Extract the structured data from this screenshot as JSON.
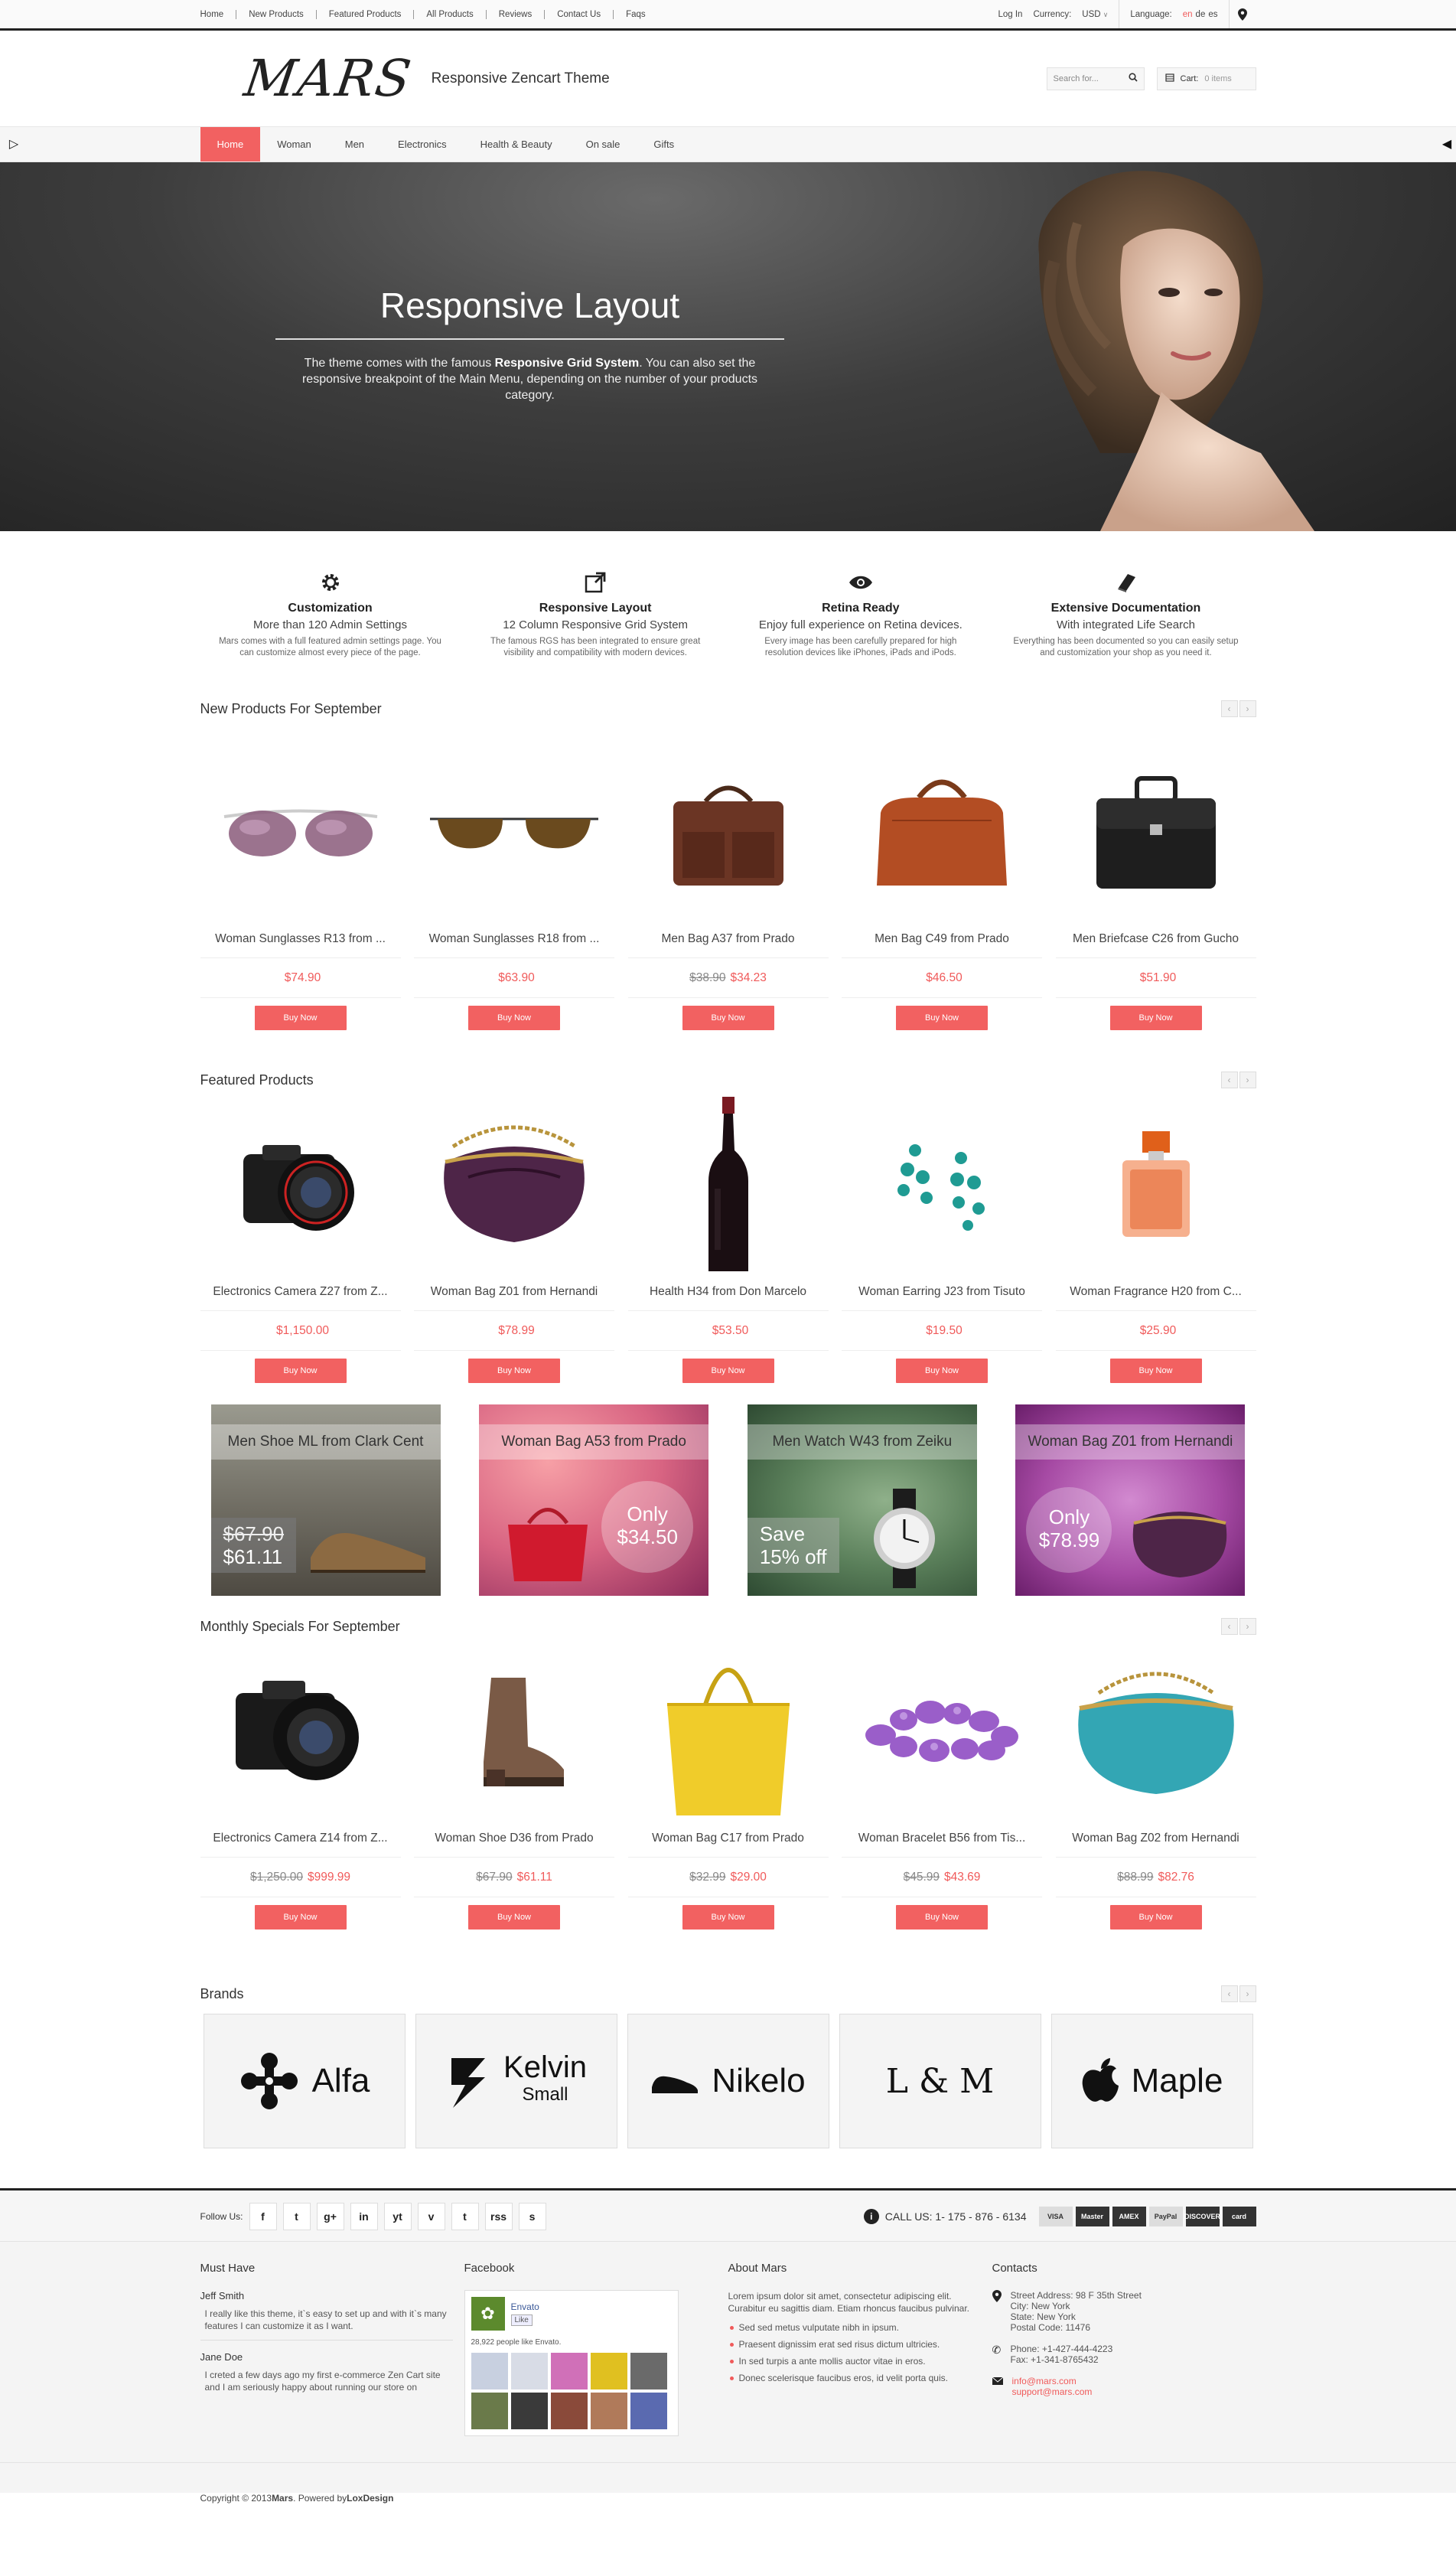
{
  "topbar": {
    "links": [
      "Home",
      "New Products",
      "Featured Products",
      "All Products",
      "Reviews",
      "Contact Us",
      "Faqs"
    ],
    "login": "Log In",
    "currency_label": "Currency:",
    "currency_value": "USD",
    "language_label": "Language:",
    "languages": [
      "en",
      "de",
      "es"
    ]
  },
  "header": {
    "logo": "MARS",
    "tagline": "Responsive Zencart Theme",
    "search_placeholder": "Search for...",
    "cart_label": "Cart:",
    "cart_count": "0 items"
  },
  "nav": {
    "items": [
      "Home",
      "Woman",
      "Men",
      "Electronics",
      "Health & Beauty",
      "On sale",
      "Gifts"
    ]
  },
  "hero": {
    "title": "Responsive Layout",
    "text_pre": "The theme comes with the famous ",
    "text_bold": "Responsive Grid System",
    "text_post": ". You can also set the responsive breakpoint of the Main Menu, depending on the number of your products category."
  },
  "features": [
    {
      "icon": "gear-icon",
      "title": "Customization",
      "sub": "More than 120 Admin Settings",
      "desc": "Mars comes with a full featured admin settings page. You can customize almost every piece of the page."
    },
    {
      "icon": "expand-icon",
      "title": "Responsive Layout",
      "sub": "12 Column Responsive Grid System",
      "desc": "The famous RGS has been integrated to ensure great visibility and compatibility with modern devices."
    },
    {
      "icon": "eye-icon",
      "title": "Retina Ready",
      "sub": "Enjoy full experience on Retina devices.",
      "desc": "Every image has been carefully prepared for high resolution devices like iPhones, iPads and iPods."
    },
    {
      "icon": "book-icon",
      "title": "Extensive Documentation",
      "sub": "With integrated Life Search",
      "desc": "Everything has been documented so you can easily setup and customization your shop as you need it."
    }
  ],
  "new_products": {
    "title": "New Products For September",
    "items": [
      {
        "name": "Woman Sunglasses R13 from ...",
        "old": "",
        "price": "$74.90",
        "buy": "Buy Now"
      },
      {
        "name": "Woman Sunglasses R18 from ...",
        "old": "",
        "price": "$63.90",
        "buy": "Buy Now"
      },
      {
        "name": "Men Bag A37 from Prado",
        "old": "$38.90",
        "price": "$34.23",
        "buy": "Buy Now"
      },
      {
        "name": "Men Bag C49 from Prado",
        "old": "",
        "price": "$46.50",
        "buy": "Buy Now"
      },
      {
        "name": "Men Briefcase C26 from Gucho",
        "old": "",
        "price": "$51.90",
        "buy": "Buy Now"
      }
    ]
  },
  "featured_products": {
    "title": "Featured Products",
    "items": [
      {
        "name": "Electronics Camera Z27 from Z...",
        "old": "",
        "price": "$1,150.00",
        "buy": "Buy Now"
      },
      {
        "name": "Woman Bag Z01 from Hernandi",
        "old": "",
        "price": "$78.99",
        "buy": "Buy Now"
      },
      {
        "name": "Health H34 from Don Marcelo",
        "old": "",
        "price": "$53.50",
        "buy": "Buy Now"
      },
      {
        "name": "Woman Earring J23 from Tisuto",
        "old": "",
        "price": "$19.50",
        "buy": "Buy Now"
      },
      {
        "name": "Woman Fragrance H20 from C...",
        "old": "",
        "price": "$25.90",
        "buy": "Buy Now"
      }
    ]
  },
  "banners": [
    {
      "title": "Men Shoe ML from Clark Cent",
      "line1": "$67.90",
      "line2": "$61.11"
    },
    {
      "title": "Woman Bag A53 from Prado",
      "line1": "Only",
      "line2": "$34.50"
    },
    {
      "title": "Men Watch W43 from Zeiku",
      "line1": "Save",
      "line2": "15% off"
    },
    {
      "title": "Woman Bag Z01 from Hernandi",
      "line1": "Only",
      "line2": "$78.99"
    }
  ],
  "monthly_specials": {
    "title": "Monthly Specials For September",
    "items": [
      {
        "name": "Electronics Camera Z14 from Z...",
        "old": "$1,250.00",
        "price": "$999.99",
        "buy": "Buy Now"
      },
      {
        "name": "Woman Shoe D36 from Prado",
        "old": "$67.90",
        "price": "$61.11",
        "buy": "Buy Now"
      },
      {
        "name": "Woman Bag C17 from Prado",
        "old": "$32.99",
        "price": "$29.00",
        "buy": "Buy Now"
      },
      {
        "name": "Woman Bracelet B56 from Tis...",
        "old": "$45.99",
        "price": "$43.69",
        "buy": "Buy Now"
      },
      {
        "name": "Woman Bag Z02 from Hernandi",
        "old": "$88.99",
        "price": "$82.76",
        "buy": "Buy Now"
      }
    ]
  },
  "brands": {
    "title": "Brands",
    "items": [
      "Alfa",
      "Kelvin",
      "Nikelo",
      "L & M",
      "Maple"
    ],
    "kelvin_sub": "Small"
  },
  "follow": {
    "label": "Follow Us:",
    "call": "CALL US: 1- 175 - 876 - 6134",
    "social": [
      "f",
      "t",
      "g+",
      "in",
      "yt",
      "v",
      "t",
      "rss",
      "s"
    ],
    "cards": [
      "VISA",
      "Master",
      "AMEX",
      "PayPal",
      "DISCOVER",
      "card"
    ]
  },
  "footer": {
    "must_have": {
      "title": "Must Have",
      "testimonials": [
        {
          "name": "Jeff Smith",
          "text": "I really like this theme, it`s easy to set up and with it`s many features I can customize it as I want."
        },
        {
          "name": "Jane Doe",
          "text": "I creted a few days ago my first e-commerce Zen Cart site and I am seriously happy about running our store on"
        }
      ]
    },
    "facebook": {
      "title": "Facebook",
      "page": "Envato",
      "like": "Like",
      "count": "28,922 people like Envato."
    },
    "about": {
      "title": "About Mars",
      "text": "Lorem ipsum dolor sit amet, consectetur adipiscing elit. Curabitur eu sagittis diam. Etiam rhoncus faucibus pulvinar.",
      "bullets": [
        "Sed sed metus vulputate nibh in ipsum.",
        "Praesent dignissim erat sed risus dictum ultricies.",
        "In sed turpis a ante mollis auctor vitae in eros.",
        "Donec scelerisque faucibus eros, id velit porta quis."
      ]
    },
    "contacts": {
      "title": "Contacts",
      "address": [
        "Street Address: 98 F 35th Street",
        "City: New York",
        "State: New York",
        "Postal Code: 11476"
      ],
      "phone": "Phone: +1-427-444-4223",
      "fax": "Fax: +1-341-8765432",
      "email1": "info@mars.com",
      "email2": "support@mars.com"
    },
    "copyright_pre": "Copyright © 2013 ",
    "copyright_brand": "Mars",
    "copyright_mid": ". Powered by ",
    "copyright_by": "LoxDesign"
  },
  "colors": {
    "accent": "#f26161",
    "dark": "#222222"
  }
}
